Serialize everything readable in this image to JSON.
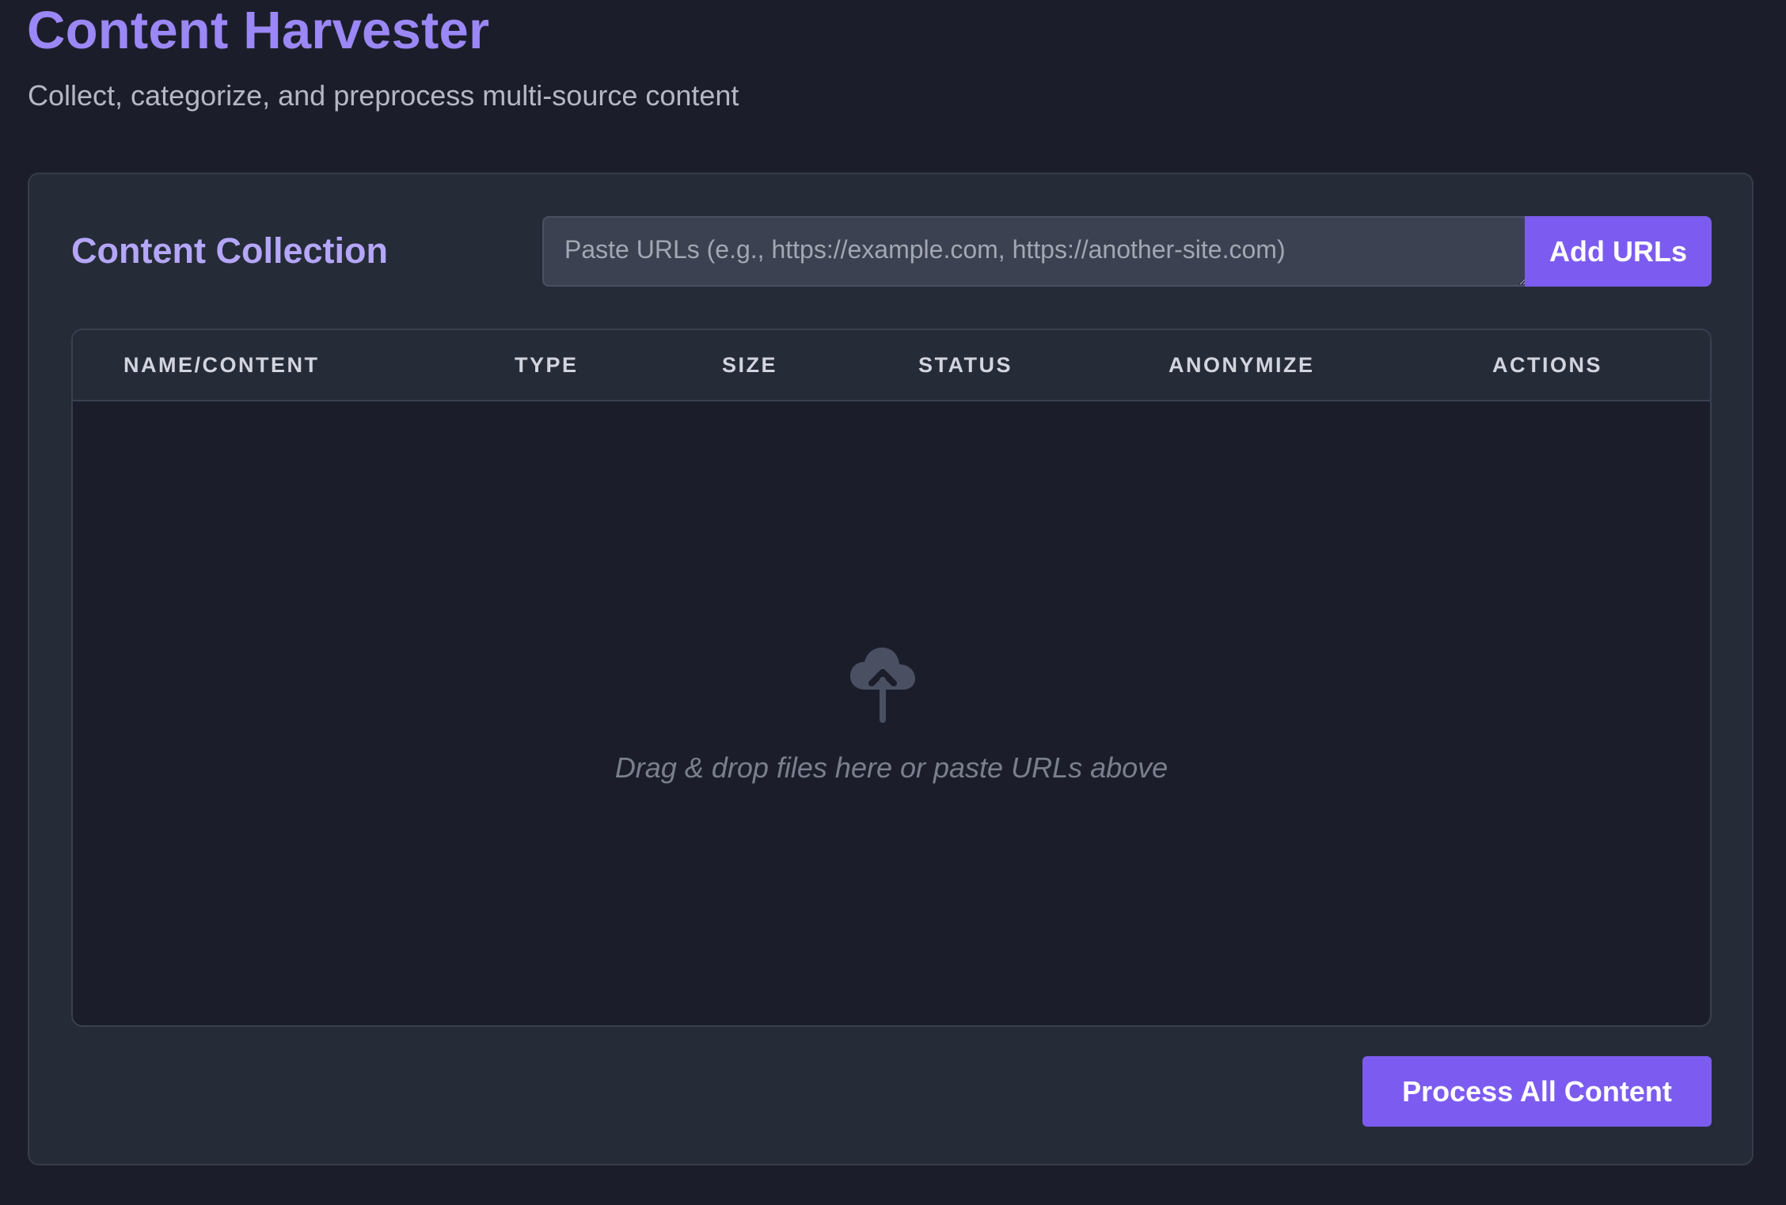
{
  "header": {
    "title": "Content Harvester",
    "subtitle": "Collect, categorize, and preprocess multi-source content"
  },
  "collection": {
    "title": "Content Collection",
    "url_input": {
      "placeholder": "Paste URLs (e.g., https://example.com, https://another-site.com)",
      "value": ""
    },
    "add_button_label": "Add URLs"
  },
  "table": {
    "columns": [
      "NAME/CONTENT",
      "TYPE",
      "SIZE",
      "STATUS",
      "ANONYMIZE",
      "ACTIONS"
    ],
    "rows": [],
    "empty_icon": "cloud-upload-icon",
    "empty_message": "Drag & drop files here or paste URLs above"
  },
  "actions": {
    "process_button_label": "Process All Content"
  },
  "colors": {
    "background": "#1b1e2a",
    "panel": "#262b38",
    "accent": "#7c5cf0",
    "title": "#9b87f5"
  }
}
